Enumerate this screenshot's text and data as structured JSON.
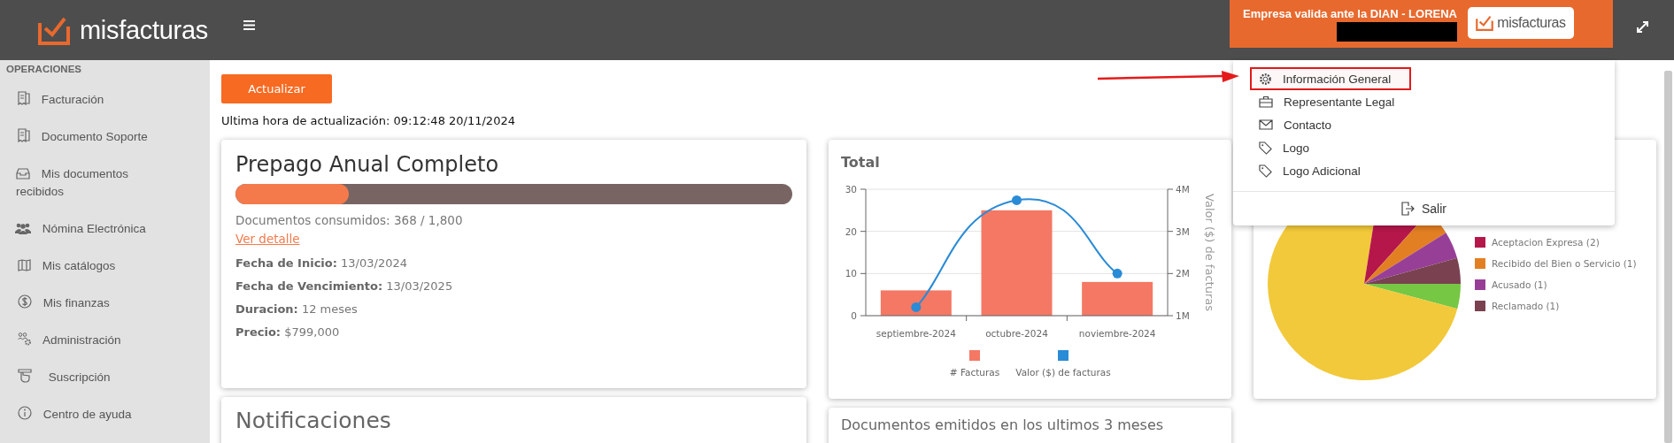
{
  "header": {
    "logo_text": "misfacturas",
    "company_banner": {
      "text": "Empresa valida ante la DIAN - LORENA",
      "badge_text": "misfacturas"
    }
  },
  "sidebar": {
    "section_title": "OPERACIONES",
    "items": [
      {
        "label": "Facturación",
        "kind": "receipt"
      },
      {
        "label": "Documento Soporte",
        "kind": "receipt"
      },
      {
        "label": "Mis documentos recibidos",
        "kind": "inbox"
      },
      {
        "label": "Nómina Electrónica",
        "kind": "users"
      },
      {
        "label": "Mis catálogos",
        "kind": "map"
      },
      {
        "label": "Mis finanzas",
        "kind": "dollar"
      },
      {
        "label": "Administración",
        "kind": "people-gear"
      },
      {
        "label": "Suscripción",
        "kind": "hand"
      },
      {
        "label": "Centro de ayuda",
        "kind": "info"
      }
    ]
  },
  "toolbar": {
    "update_button": "Actualizar",
    "last_update": "Ultima hora de actualización: 09:12:48 20/11/2024"
  },
  "plan_card": {
    "title": "Prepago Anual Completo",
    "level": 0.204,
    "consumed": "Documentos consumidos: 368 / 1,800",
    "detail_link": "Ver detalle",
    "fields": [
      {
        "label": "Fecha de Inicio:",
        "value": "13/03/2024"
      },
      {
        "label": "Fecha de Vencimiento:",
        "value": "13/03/2025"
      },
      {
        "label": "Duracion:",
        "value": "12 meses"
      },
      {
        "label": "Precio:",
        "value": "$799,000"
      }
    ]
  },
  "notifications_card": {
    "title": "Notificaciones"
  },
  "total_chart_card": {
    "title": "Total",
    "chart_data": {
      "type": "bar",
      "categories": [
        "septiembre-2024",
        "octubre-2024",
        "noviembre-2024"
      ],
      "series": [
        {
          "name": "# Facturas",
          "color": "#f47864",
          "values": [
            6,
            25,
            8
          ]
        },
        {
          "name": "Valor ($) de facturas",
          "color": "#2a8bd6",
          "type": "line",
          "axis": "y2",
          "marker": "circle",
          "values": [
            1200000,
            3740000,
            2000000
          ]
        }
      ],
      "legend": "bottom",
      "ylim": [
        0,
        30
      ],
      "yticks": [
        0,
        10,
        20,
        30
      ],
      "y2label": "Valor ($) de facturas",
      "y2lim": [
        1000000,
        4000000
      ],
      "y2ticks": [
        {
          "value": 1000000,
          "label": "1M"
        },
        {
          "value": 2000000,
          "label": "2M"
        },
        {
          "value": 3000000,
          "label": "3M"
        },
        {
          "value": 4000000,
          "label": "4M"
        }
      ]
    }
  },
  "status_card": {
    "legend": [
      {
        "label": "Aceptacion Expresa (2)",
        "color": "#b5174b"
      },
      {
        "label": "Recibido del Bien o Servicio (1)",
        "color": "#e37f23"
      },
      {
        "label": "Acusado (1)",
        "color": "#973f97"
      },
      {
        "label": "Reclamado (1)",
        "color": "#7a4250"
      }
    ]
  },
  "emitted_card": {
    "title": "Documentos emitidos en los ultimos 3 meses"
  },
  "account_menu": {
    "items": [
      {
        "label": "Información General",
        "kind": "gear",
        "highlighted": true
      },
      {
        "label": "Representante Legal",
        "kind": "briefcase",
        "highlighted": false
      },
      {
        "label": "Contacto",
        "kind": "mail",
        "highlighted": false
      },
      {
        "label": "Logo",
        "kind": "tag",
        "highlighted": false
      },
      {
        "label": "Logo Adicional",
        "kind": "tag",
        "highlighted": false
      }
    ],
    "logout": "Salir"
  }
}
